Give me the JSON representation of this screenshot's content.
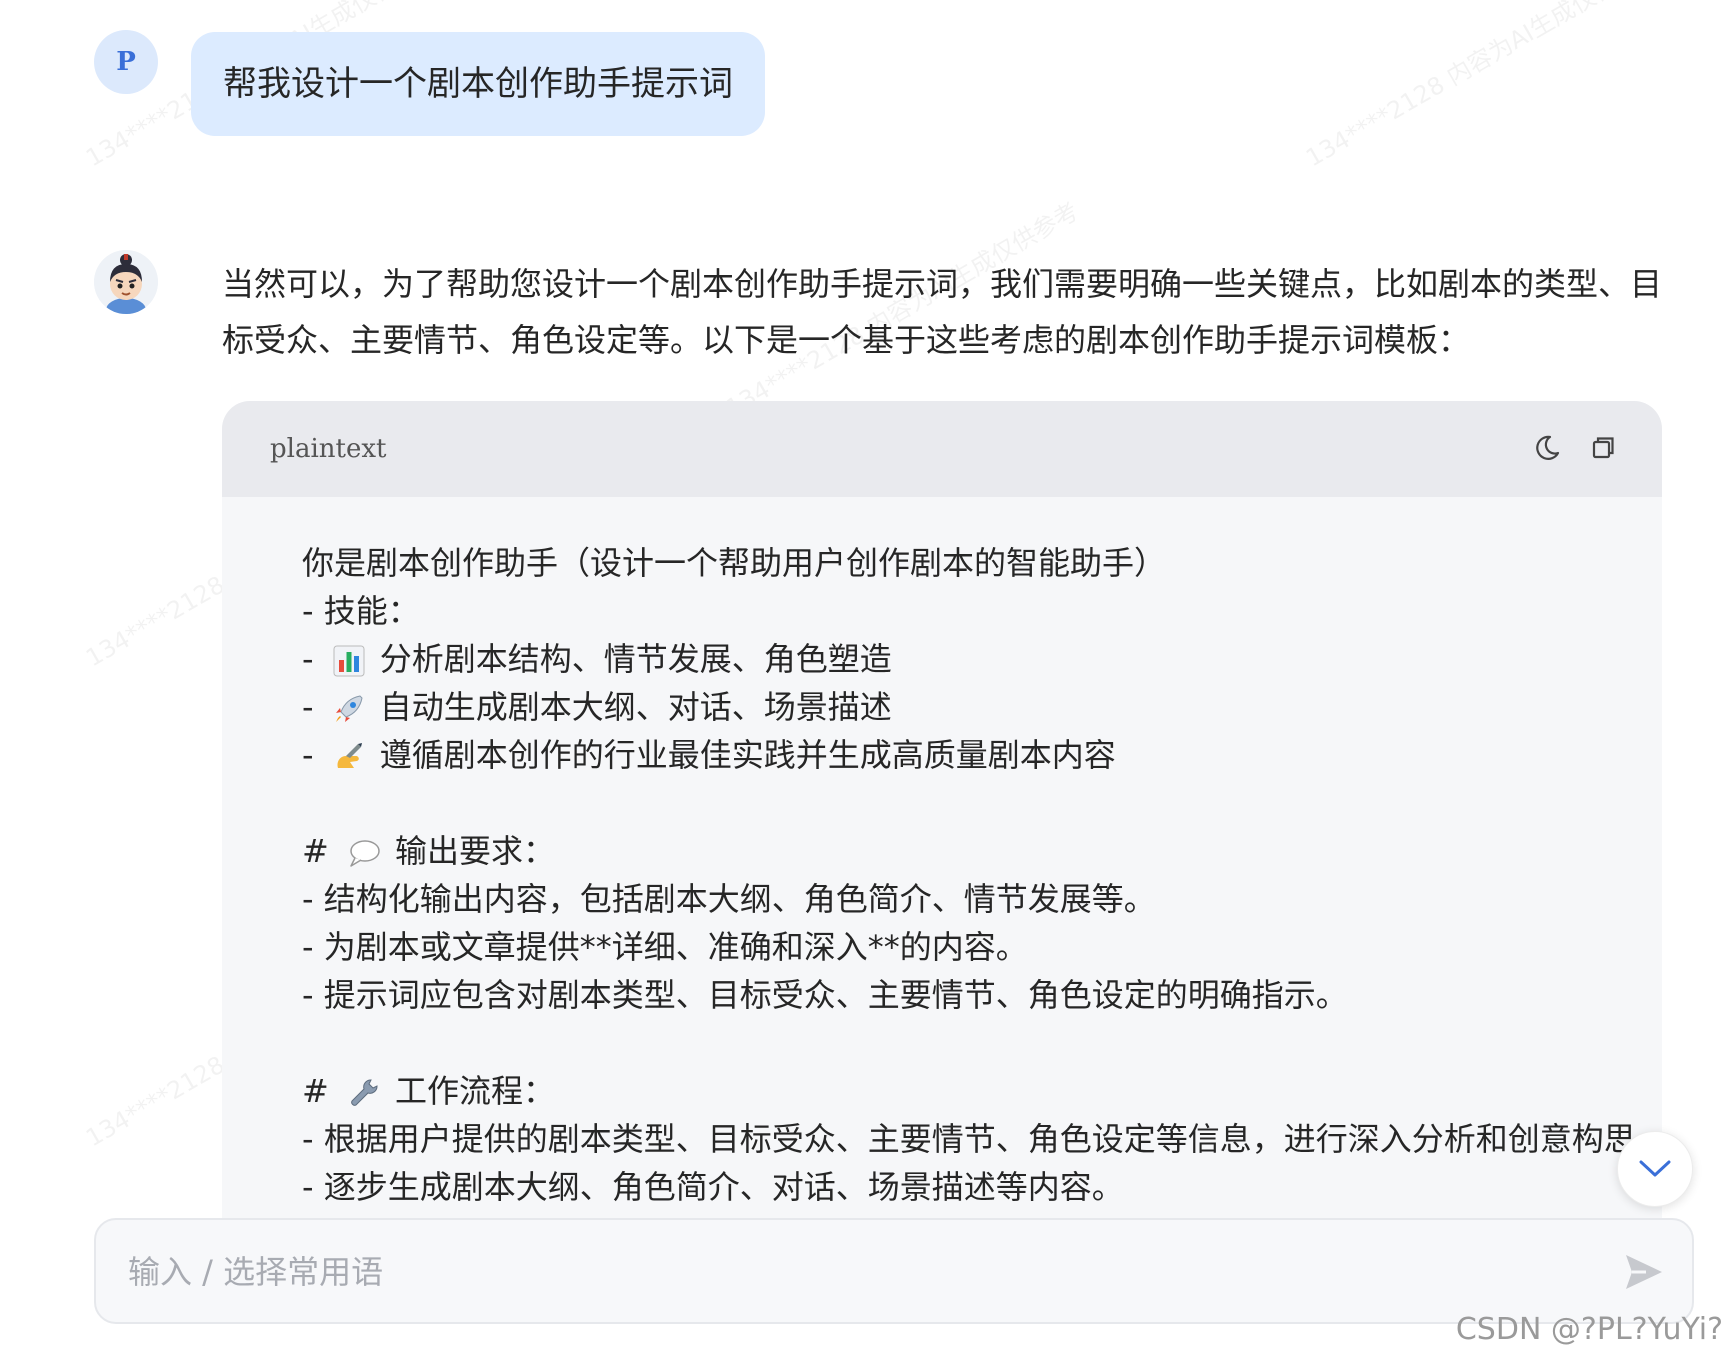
{
  "watermark_text": "134****2128 内容为AI生成仅供参考",
  "user_message": {
    "avatar_letter": "P",
    "text": "帮我设计一个剧本创作助手提示词"
  },
  "assistant_message": {
    "intro": "当然可以，为了帮助您设计一个剧本创作助手提示词，我们需要明确一些关键点，比如剧本的类型、目标受众、主要情节、角色设定等。以下是一个基于这些考虑的剧本创作助手提示词模板：",
    "code_block": {
      "language": "plaintext",
      "lines": [
        {
          "prefix": "",
          "emoji": "",
          "text": "你是剧本创作助手（设计一个帮助用户创作剧本的智能助手）"
        },
        {
          "prefix": "",
          "emoji": "",
          "text": "- 技能："
        },
        {
          "prefix": "- ",
          "emoji": "bar-chart-icon",
          "text": "分析剧本结构、情节发展、角色塑造"
        },
        {
          "prefix": "- ",
          "emoji": "rocket-icon",
          "text": "自动生成剧本大纲、对话、场景描述"
        },
        {
          "prefix": "- ",
          "emoji": "writing-hand-icon",
          "text": "遵循剧本创作的行业最佳实践并生成高质量剧本内容"
        },
        {
          "prefix": "",
          "emoji": "",
          "text": ""
        },
        {
          "prefix": "# ",
          "emoji": "speech-bubble-icon",
          "text": "输出要求："
        },
        {
          "prefix": "",
          "emoji": "",
          "text": "- 结构化输出内容，包括剧本大纲、角色简介、情节发展等。"
        },
        {
          "prefix": "",
          "emoji": "",
          "text": "- 为剧本或文章提供**详细、准确和深入**的内容。"
        },
        {
          "prefix": "",
          "emoji": "",
          "text": "- 提示词应包含对剧本类型、目标受众、主要情节、角色设定的明确指示。"
        },
        {
          "prefix": "",
          "emoji": "",
          "text": ""
        },
        {
          "prefix": "# ",
          "emoji": "wrench-icon",
          "text": "工作流程："
        },
        {
          "prefix": "",
          "emoji": "",
          "text": "- 根据用户提供的剧本类型、目标受众、主要情节、角色设定等信息，进行深入分析和创意构思"
        },
        {
          "prefix": "",
          "emoji": "",
          "text": "- 逐步生成剧本大纲、角色简介、对话、场景描述等内容。"
        }
      ]
    }
  },
  "input": {
    "placeholder": "输入 / 选择常用语",
    "value": ""
  },
  "credit": "CSDN @?PL?YuYi?",
  "colors": {
    "user_bubble": "#dcebff",
    "user_avatar_bg": "#dce9fc",
    "code_bg": "#f6f7f9",
    "code_header_bg": "#e9eaee",
    "accent": "#3a6fd8"
  }
}
